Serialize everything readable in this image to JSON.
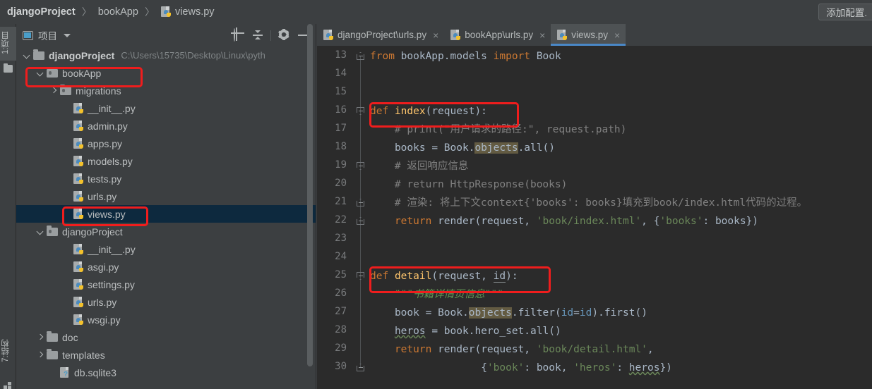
{
  "window": {
    "breadcrumb": {
      "root": "djangoProject",
      "middle": "bookApp",
      "file": "views.py",
      "separator": "〉"
    },
    "add_config_button": "添加配置."
  },
  "left_strip": {
    "project_tab": "1:项目",
    "structure_tab": "7:结构"
  },
  "project_panel": {
    "title": "项目",
    "tools": [
      "locate-target-icon",
      "collapse-all-icon",
      "gear-icon",
      "minimize-icon"
    ],
    "tree": [
      {
        "label": "djangoProject",
        "path": "C:\\Users\\15735\\Desktop\\Linux\\pyth",
        "type": "folder",
        "indent": 0,
        "arrow": "down",
        "bold": true,
        "selected": false
      },
      {
        "label": "bookApp",
        "path": "",
        "type": "source-folder",
        "indent": 1,
        "arrow": "down",
        "bold": false,
        "selected": false
      },
      {
        "label": "migrations",
        "path": "",
        "type": "source-folder",
        "indent": 2,
        "arrow": "right",
        "bold": false,
        "selected": false
      },
      {
        "label": "__init__.py",
        "path": "",
        "type": "python",
        "indent": 3,
        "arrow": "none",
        "bold": false,
        "selected": false
      },
      {
        "label": "admin.py",
        "path": "",
        "type": "python",
        "indent": 3,
        "arrow": "none",
        "bold": false,
        "selected": false
      },
      {
        "label": "apps.py",
        "path": "",
        "type": "python",
        "indent": 3,
        "arrow": "none",
        "bold": false,
        "selected": false
      },
      {
        "label": "models.py",
        "path": "",
        "type": "python",
        "indent": 3,
        "arrow": "none",
        "bold": false,
        "selected": false
      },
      {
        "label": "tests.py",
        "path": "",
        "type": "python",
        "indent": 3,
        "arrow": "none",
        "bold": false,
        "selected": false
      },
      {
        "label": "urls.py",
        "path": "",
        "type": "python",
        "indent": 3,
        "arrow": "none",
        "bold": false,
        "selected": false
      },
      {
        "label": "views.py",
        "path": "",
        "type": "python",
        "indent": 3,
        "arrow": "none",
        "bold": false,
        "selected": true
      },
      {
        "label": "djangoProject",
        "path": "",
        "type": "source-folder",
        "indent": 1,
        "arrow": "down",
        "bold": false,
        "selected": false
      },
      {
        "label": "__init__.py",
        "path": "",
        "type": "python",
        "indent": 3,
        "arrow": "none",
        "bold": false,
        "selected": false
      },
      {
        "label": "asgi.py",
        "path": "",
        "type": "python",
        "indent": 3,
        "arrow": "none",
        "bold": false,
        "selected": false
      },
      {
        "label": "settings.py",
        "path": "",
        "type": "python",
        "indent": 3,
        "arrow": "none",
        "bold": false,
        "selected": false
      },
      {
        "label": "urls.py",
        "path": "",
        "type": "python",
        "indent": 3,
        "arrow": "none",
        "bold": false,
        "selected": false
      },
      {
        "label": "wsgi.py",
        "path": "",
        "type": "python",
        "indent": 3,
        "arrow": "none",
        "bold": false,
        "selected": false
      },
      {
        "label": "doc",
        "path": "",
        "type": "folder",
        "indent": 1,
        "arrow": "right",
        "bold": false,
        "selected": false
      },
      {
        "label": "templates",
        "path": "",
        "type": "folder",
        "indent": 1,
        "arrow": "right",
        "bold": false,
        "selected": false
      },
      {
        "label": "db.sqlite3",
        "path": "",
        "type": "unknown-file",
        "indent": 2,
        "arrow": "none",
        "bold": false,
        "selected": false
      }
    ]
  },
  "editor": {
    "tabs": [
      {
        "label": "djangoProject\\urls.py",
        "active": false,
        "close": "×"
      },
      {
        "label": "bookApp\\urls.py",
        "active": false,
        "close": "×"
      },
      {
        "label": "views.py",
        "active": true,
        "close": "×"
      }
    ],
    "first_line_number": 13,
    "lines": [
      {
        "n": 13,
        "text": "from bookApp.models import Book"
      },
      {
        "n": 14,
        "text": ""
      },
      {
        "n": 15,
        "text": ""
      },
      {
        "n": 16,
        "text": "def index(request):"
      },
      {
        "n": 17,
        "text": "    # print(\"用户请求的路径:\", request.path)"
      },
      {
        "n": 18,
        "text": "    books = Book.objects.all()"
      },
      {
        "n": 19,
        "text": "    # 返回响应信息"
      },
      {
        "n": 20,
        "text": "    # return HttpResponse(books)"
      },
      {
        "n": 21,
        "text": "    # 渲染: 将上下文context{'books': books}填充到book/index.html代码的过程。"
      },
      {
        "n": 22,
        "text": "    return render(request, 'book/index.html', {'books': books})"
      },
      {
        "n": 23,
        "text": ""
      },
      {
        "n": 24,
        "text": ""
      },
      {
        "n": 25,
        "text": "def detail(request, id):"
      },
      {
        "n": 26,
        "text": "    \"\"\"书籍详情页信息\"\"\""
      },
      {
        "n": 27,
        "text": "    book = Book.objects.filter(id=id).first()"
      },
      {
        "n": 28,
        "text": "    heros = book.hero_set.all()"
      },
      {
        "n": 29,
        "text": "    return render(request, 'book/detail.html',"
      },
      {
        "n": 30,
        "text": "                  {'book': book, 'heros': heros})"
      }
    ]
  },
  "annotations": {
    "boxes": [
      "bookApp-tree-item",
      "views-py-tree-item",
      "def-index-line",
      "def-detail-line"
    ],
    "color": "#ef1d1d"
  }
}
